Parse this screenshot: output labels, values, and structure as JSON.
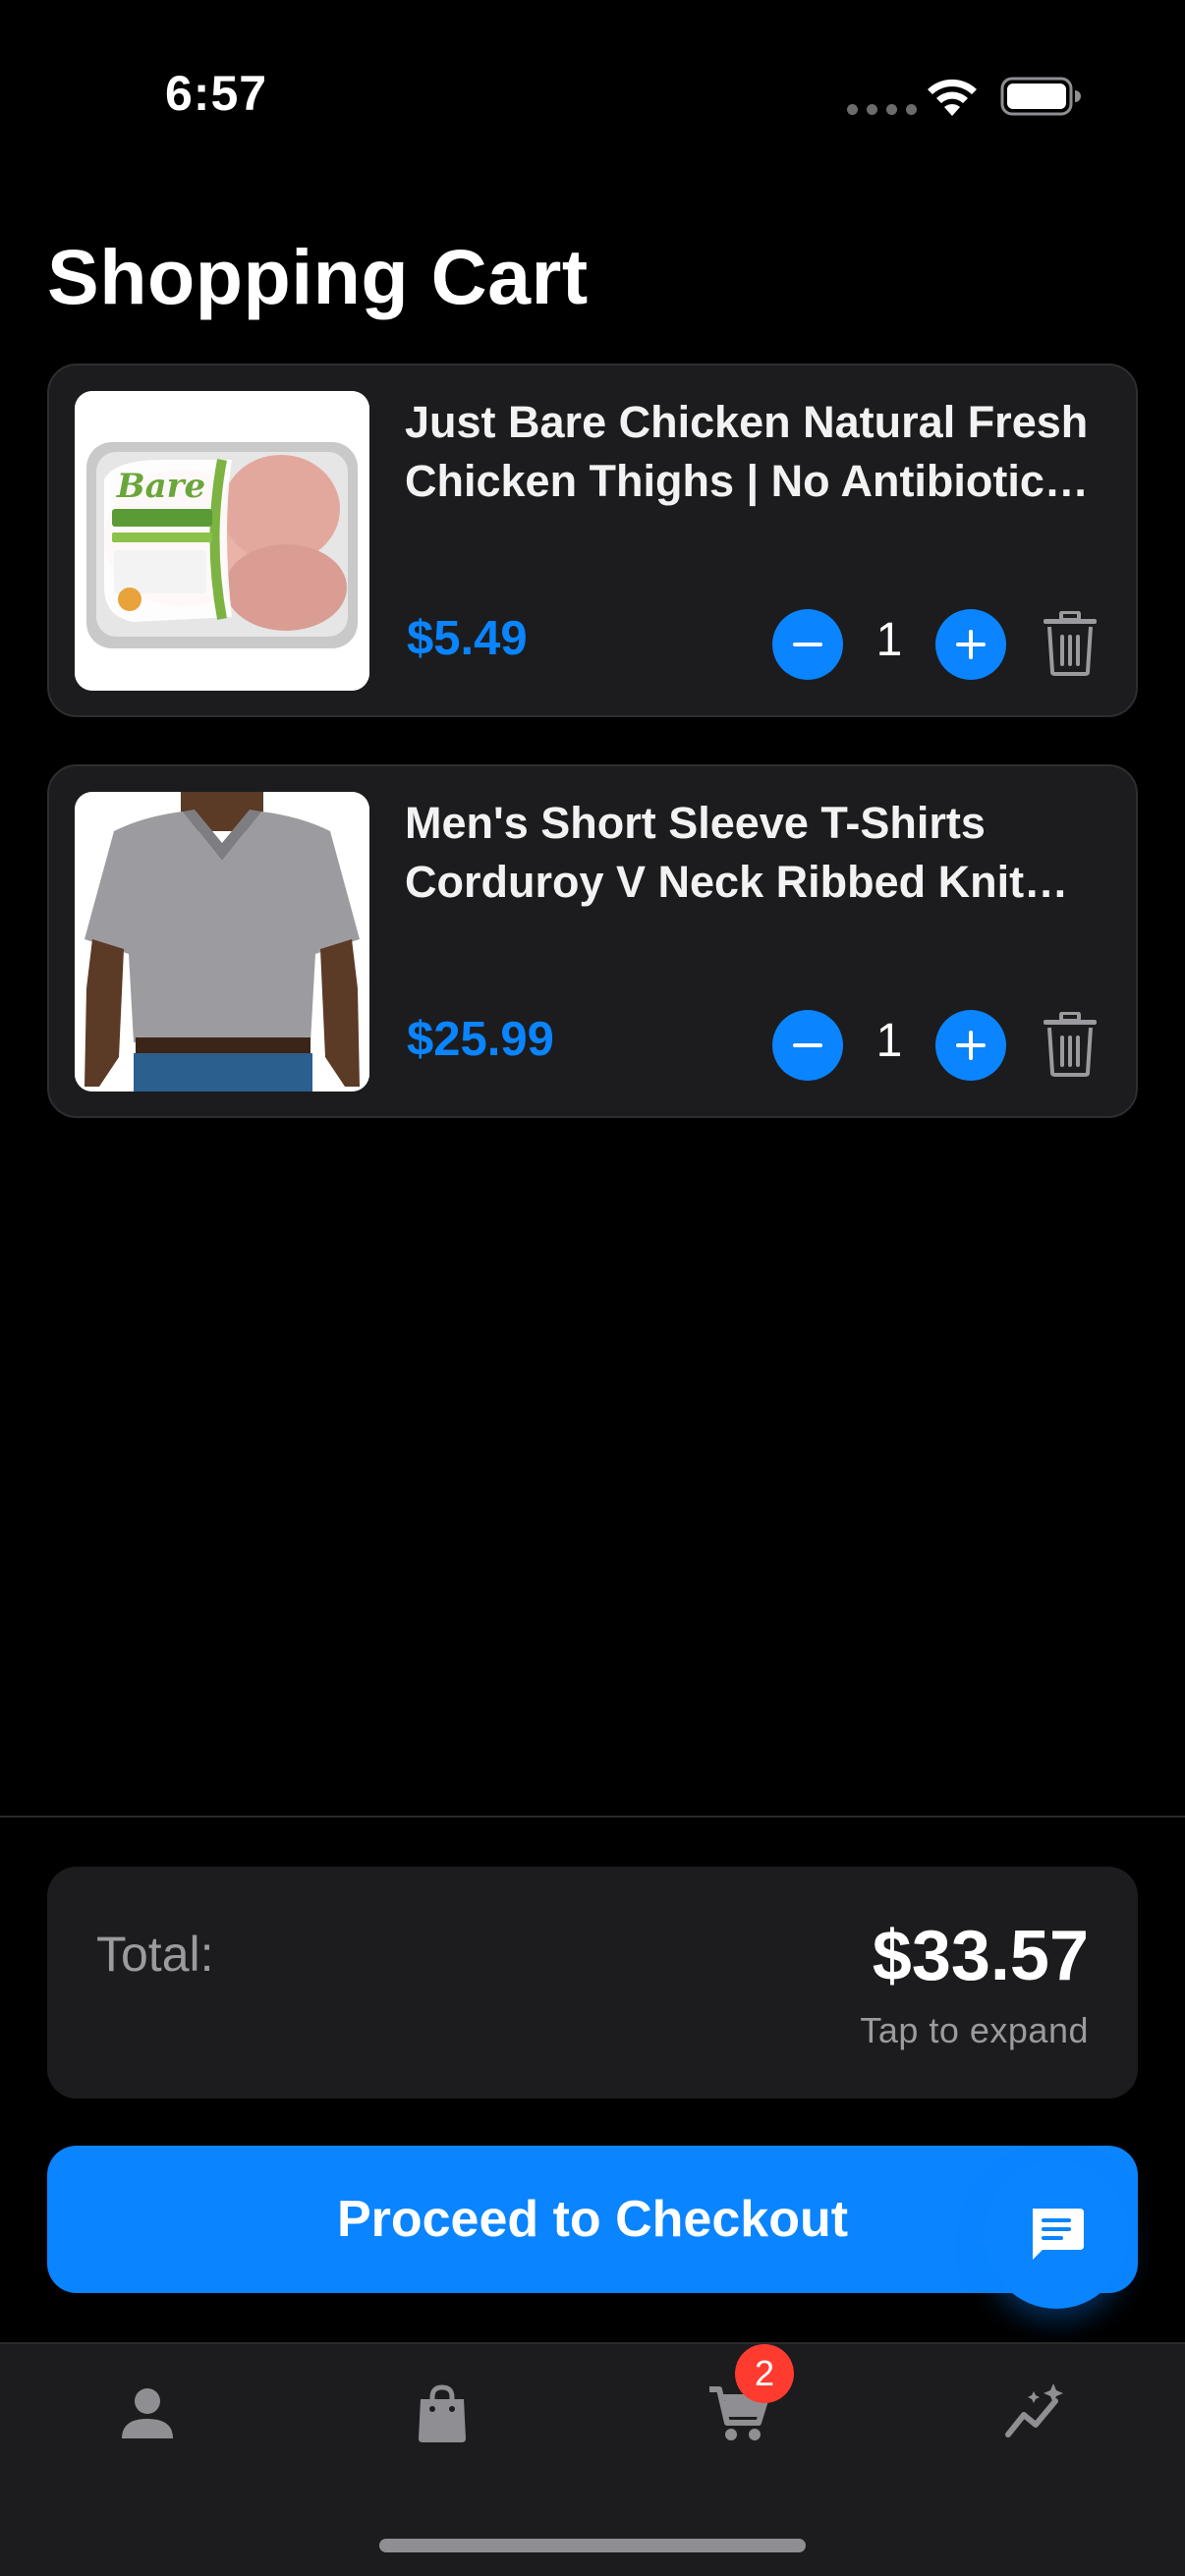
{
  "status_bar": {
    "time": "6:57",
    "icons": [
      "signal-dots-icon",
      "wifi-icon",
      "battery-icon"
    ]
  },
  "page": {
    "title": "Shopping Cart"
  },
  "cart": {
    "items": [
      {
        "name": "Just Bare Chicken Natural Fresh Chicken Thighs | No Antibiotics Ever",
        "price": "$5.49",
        "quantity": "1",
        "image": "chicken-thighs-package",
        "package_brand_art": "Bare"
      },
      {
        "name": "Men's Short Sleeve T-Shirts Corduroy V Neck Ribbed Knit Tee",
        "price": "$25.99",
        "quantity": "1",
        "image": "grey-v-neck-tshirt"
      }
    ]
  },
  "summary": {
    "total_label": "Total:",
    "total_value": "$33.57",
    "expand_hint": "Tap to expand"
  },
  "checkout": {
    "label": "Proceed to Checkout"
  },
  "chat": {
    "icon": "chat-bubble-icon"
  },
  "tab_bar": {
    "tabs": [
      {
        "icon": "person-icon"
      },
      {
        "icon": "shopping-bag-icon"
      },
      {
        "icon": "cart-icon",
        "badge": "2"
      },
      {
        "icon": "insights-icon"
      }
    ]
  },
  "colors": {
    "accent": "#0a84ff",
    "card": "#1c1c1e",
    "badge": "#ff3b30",
    "secondary_text": "#9a9a9f"
  }
}
